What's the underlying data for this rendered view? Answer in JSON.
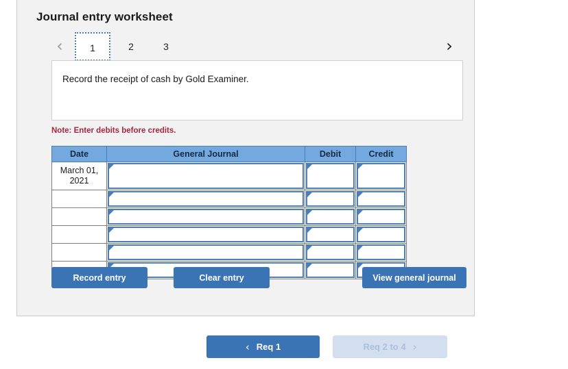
{
  "panel": {
    "title": "Journal entry worksheet"
  },
  "tabs": {
    "prev_icon": "‹",
    "next_icon": "›",
    "items": [
      {
        "label": "1",
        "active": true
      },
      {
        "label": "2",
        "active": false
      },
      {
        "label": "3",
        "active": false
      }
    ]
  },
  "instruction": {
    "text": "Record the receipt of cash by Gold Examiner."
  },
  "note": {
    "text": "Note: Enter debits before credits."
  },
  "journal": {
    "headers": {
      "date": "Date",
      "general_journal": "General Journal",
      "debit": "Debit",
      "credit": "Credit"
    },
    "rows": [
      {
        "date": "March 01, 2021",
        "general_journal": "",
        "debit": "",
        "credit": ""
      },
      {
        "date": "",
        "general_journal": "",
        "debit": "",
        "credit": ""
      },
      {
        "date": "",
        "general_journal": "",
        "debit": "",
        "credit": ""
      },
      {
        "date": "",
        "general_journal": "",
        "debit": "",
        "credit": ""
      },
      {
        "date": "",
        "general_journal": "",
        "debit": "",
        "credit": ""
      },
      {
        "date": "",
        "general_journal": "",
        "debit": "",
        "credit": ""
      }
    ]
  },
  "actions": {
    "record_entry": "Record entry",
    "clear_entry": "Clear entry",
    "view_general_journal": "View general journal"
  },
  "req_nav": {
    "prev_label": "Req 1",
    "prev_icon": "‹",
    "next_label": "Req 2 to 4",
    "next_icon": "›"
  },
  "colors": {
    "accent_blue": "#3b74b5",
    "header_blue": "#74a9e0",
    "cell_border_blue": "#4a7ebb",
    "note_red": "#a6273f",
    "panel_bg": "#f2f2f2",
    "disabled_blue": "#d3dfef"
  }
}
